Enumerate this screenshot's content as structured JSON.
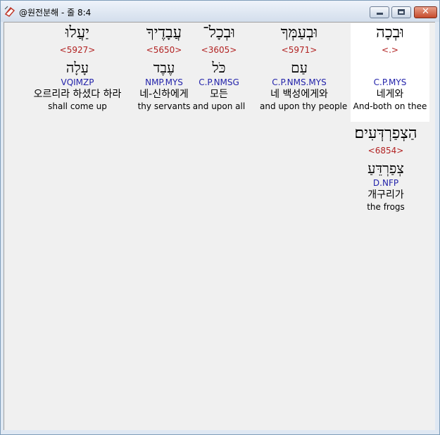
{
  "window": {
    "title": "@원전분해 - 줄 8:4"
  },
  "row1": [
    {
      "hebrew": "וּבְכָה",
      "strong": "<.>",
      "lemma": "",
      "morph": "C.P.MYS",
      "korean": "네게와",
      "english": "And-both on thee",
      "selected": true
    },
    {
      "hebrew": "וּבְעַמְּךָ",
      "strong": "<5971>",
      "lemma": "עַם",
      "morph": "C.P.NMS.MYS",
      "korean": "네 백성에게와",
      "english": "and upon thy people"
    },
    {
      "hebrew": "וּבְכָל־",
      "strong": "<3605>",
      "lemma": "כֹּל",
      "morph": "C.P.NMSG",
      "korean": "모든",
      "english": "and upon all"
    },
    {
      "hebrew": "עֲבָדֶיךָ",
      "strong": "<5650>",
      "lemma": "עֶבֶד",
      "morph": "NMP.MYS",
      "korean": "네-신하에게",
      "english": "thy servants"
    },
    {
      "hebrew": "יַעֲלוּ",
      "strong": "<5927>",
      "lemma": "עָלָה",
      "morph": "VQIMZP",
      "korean": "오르리라 하셨다 하라",
      "english": "shall come up"
    }
  ],
  "row2": [
    {
      "hebrew": "הַצְפַרְדְּעִים׃",
      "strong": "<6854>",
      "lemma": "צְפַרְדֵּעַ",
      "morph": "D.NFP",
      "korean": "개구리가",
      "english": "the frogs"
    }
  ]
}
